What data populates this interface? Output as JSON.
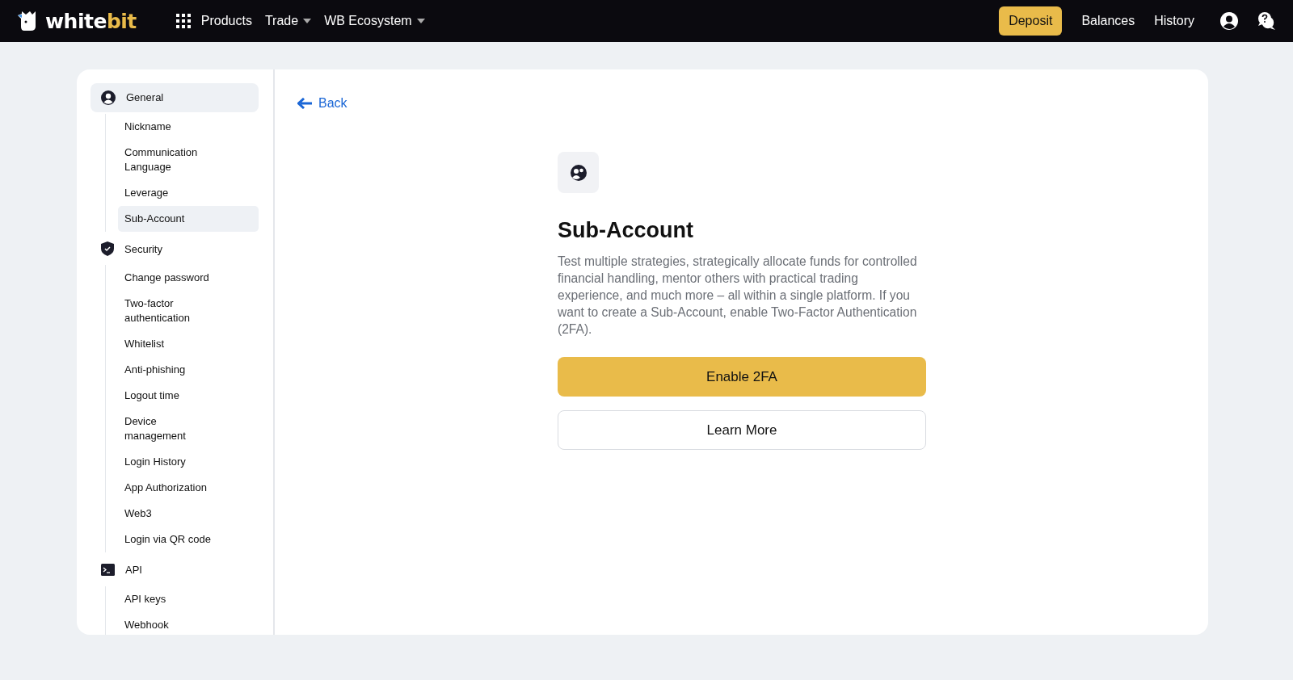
{
  "navbar": {
    "logo": {
      "main": "white",
      "accent": "bit"
    },
    "menu": [
      {
        "label": "Products",
        "kind": "grid"
      },
      {
        "label": "Trade",
        "kind": "dropdown"
      },
      {
        "label": "WB Ecosystem",
        "kind": "dropdown"
      }
    ],
    "deposit": "Deposit",
    "links": [
      "Balances",
      "History"
    ]
  },
  "sidebar": {
    "groups": [
      {
        "label": "General",
        "selected": true,
        "children": [
          {
            "label": "Nickname",
            "selected": false
          },
          {
            "label": "Communication Language",
            "selected": false
          },
          {
            "label": "Leverage",
            "selected": false
          },
          {
            "label": "Sub-Account",
            "selected": true
          }
        ]
      },
      {
        "label": "Security",
        "selected": false,
        "children": [
          {
            "label": "Change password",
            "selected": false
          },
          {
            "label": "Two-factor authentication",
            "selected": false
          },
          {
            "label": "Whitelist",
            "selected": false
          },
          {
            "label": "Anti-phishing",
            "selected": false
          },
          {
            "label": "Logout time",
            "selected": false
          },
          {
            "label": "Device management",
            "selected": false
          },
          {
            "label": "Login History",
            "selected": false
          },
          {
            "label": "App Authorization",
            "selected": false
          },
          {
            "label": "Web3",
            "selected": false
          },
          {
            "label": "Login via QR code",
            "selected": false
          }
        ]
      },
      {
        "label": "API",
        "selected": false,
        "children": [
          {
            "label": "API keys",
            "selected": false
          },
          {
            "label": "Webhook",
            "selected": false
          }
        ]
      }
    ]
  },
  "main": {
    "back": "Back",
    "title": "Sub-Account",
    "description": "Test multiple strategies, strategically allocate funds for controlled financial handling, mentor others with practical trading experience, and much more – all within a single platform. If you want to create a Sub-Account, enable Two-Factor Authentication (2FA).",
    "buttons": [
      {
        "label": "Enable 2FA",
        "kind": "primary"
      },
      {
        "label": "Learn More",
        "kind": "outline"
      }
    ]
  }
}
